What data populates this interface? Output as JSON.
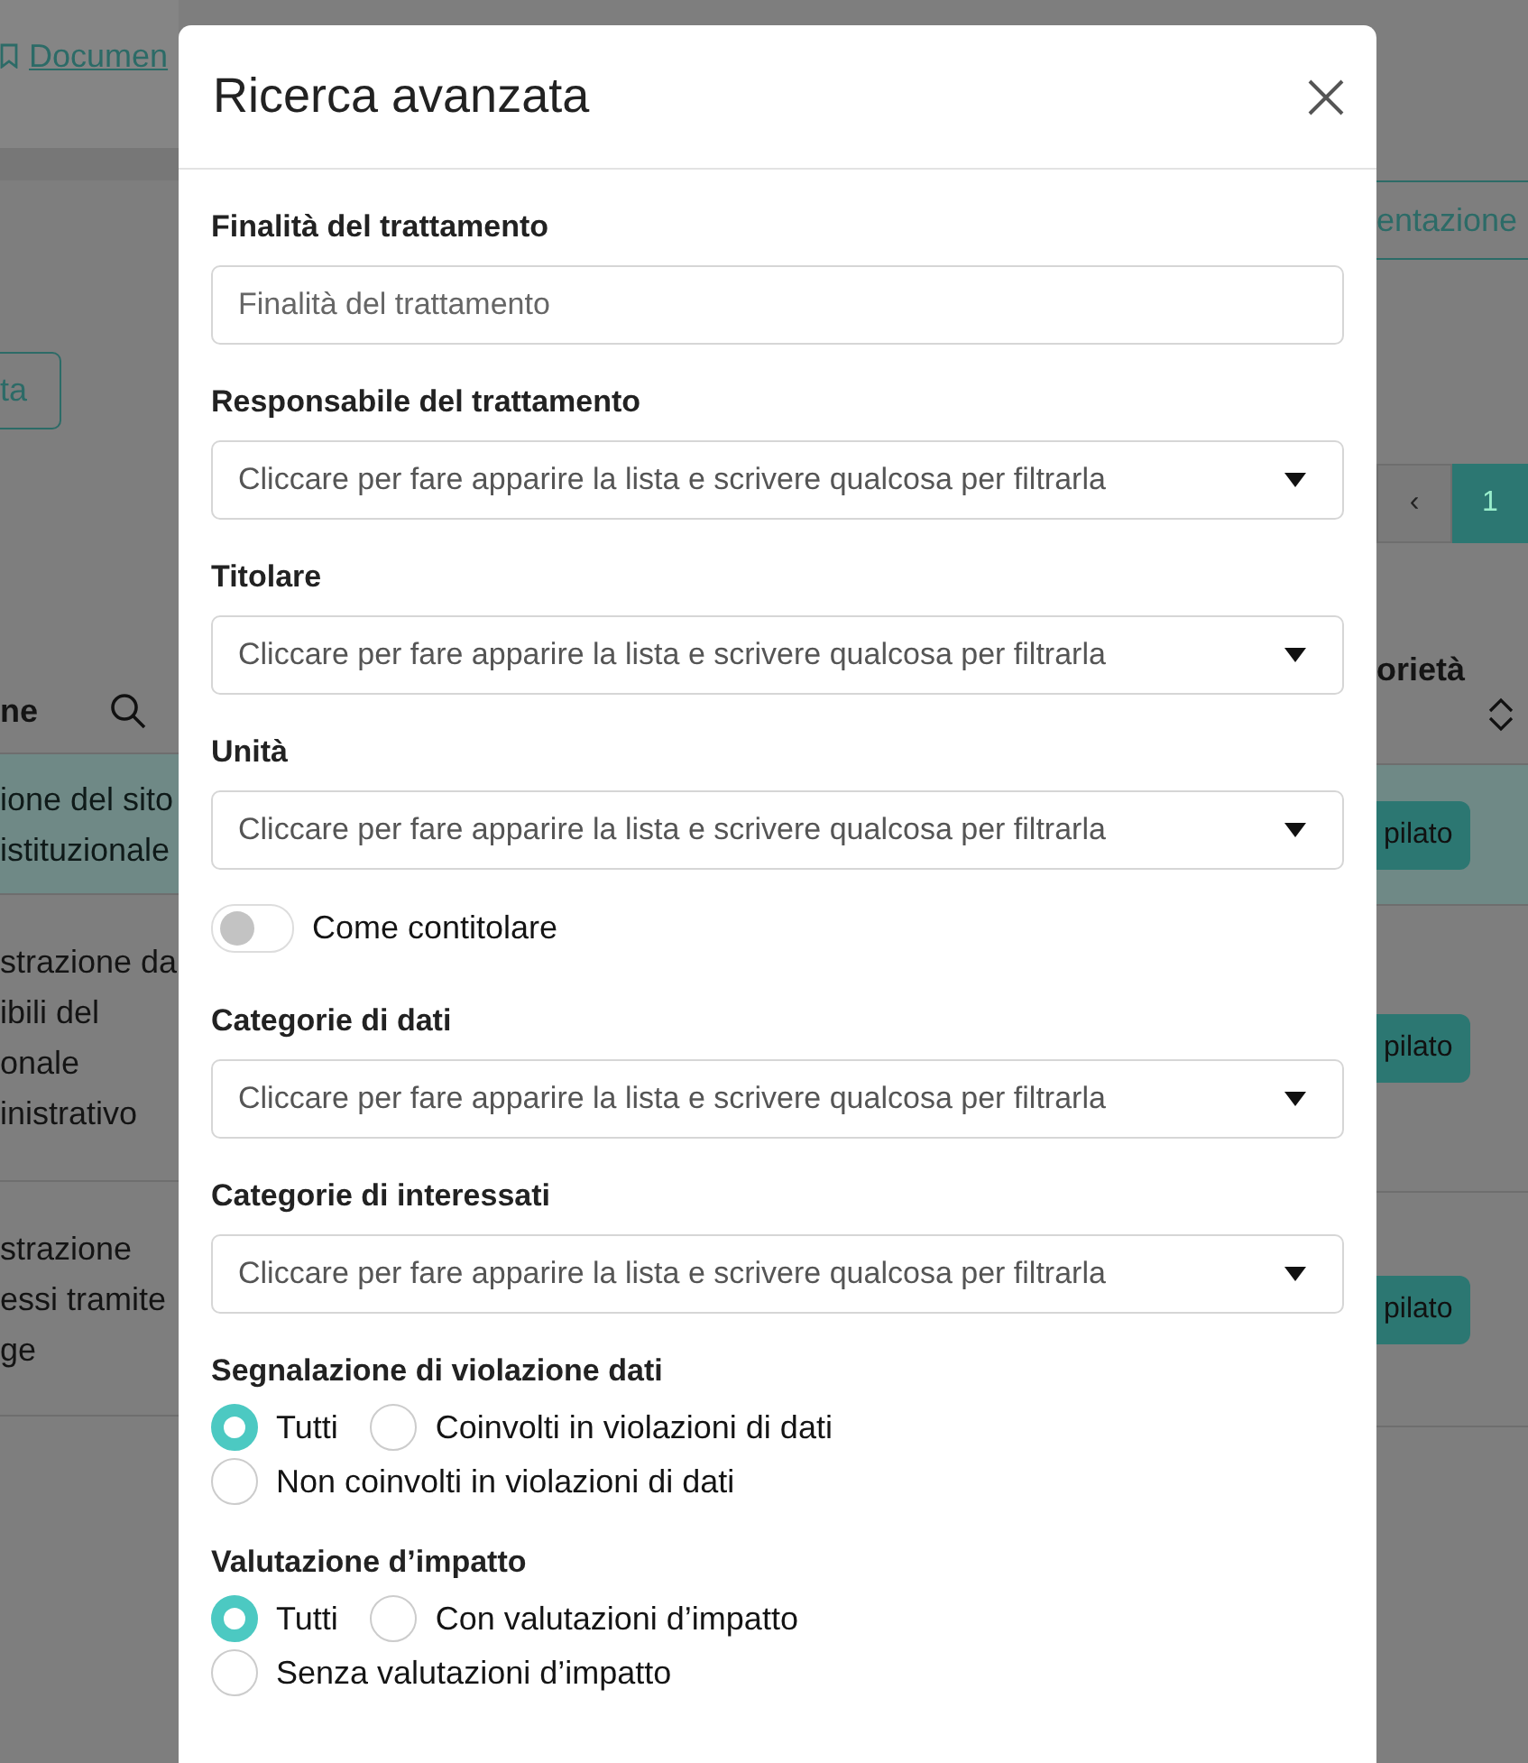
{
  "background": {
    "top_link": "Documen",
    "left_button": "ta",
    "right_button": "entazione",
    "pagination": [
      {
        "label": "‹",
        "selected": false
      },
      {
        "label": "1",
        "selected": true
      }
    ],
    "column_left": "ne",
    "column_right": "orietà",
    "rows": [
      {
        "lines": [
          "ione del sito",
          "istituzionale"
        ],
        "badge": "pilato",
        "selected": true
      },
      {
        "lines": [
          "strazione da",
          "ibili del",
          "onale",
          "inistrativo"
        ],
        "badge": "pilato",
        "selected": false
      },
      {
        "lines": [
          "strazione",
          "essi tramite",
          "ge"
        ],
        "badge": "pilato",
        "selected": false
      }
    ]
  },
  "modal": {
    "title": "Ricerca avanzata",
    "fields": [
      {
        "kind": "text",
        "label": "Finalità del trattamento",
        "placeholder": "Finalità del trattamento"
      },
      {
        "kind": "select",
        "label": "Responsabile del trattamento",
        "placeholder": "Cliccare per fare apparire la lista e scrivere qualcosa per filtrarla"
      },
      {
        "kind": "select",
        "label": "Titolare",
        "placeholder": "Cliccare per fare apparire la lista e scrivere qualcosa per filtrarla"
      },
      {
        "kind": "select",
        "label": "Unità",
        "placeholder": "Cliccare per fare apparire la lista e scrivere qualcosa per filtrarla"
      },
      {
        "kind": "toggle",
        "label": "Come contitolare",
        "on": false
      },
      {
        "kind": "select",
        "label": "Categorie di dati",
        "placeholder": "Cliccare per fare apparire la lista e scrivere qualcosa per filtrarla"
      },
      {
        "kind": "select",
        "label": "Categorie di interessati",
        "placeholder": "Cliccare per fare apparire la lista e scrivere qualcosa per filtrarla"
      },
      {
        "kind": "radio",
        "label": "Segnalazione di violazione dati",
        "options": [
          {
            "label": "Tutti",
            "selected": true
          },
          {
            "label": "Coinvolti in violazioni di dati",
            "selected": false
          },
          {
            "label": "Non coinvolti in violazioni di dati",
            "selected": false
          }
        ]
      },
      {
        "kind": "radio",
        "label": "Valutazione d’impatto",
        "options": [
          {
            "label": "Tutti",
            "selected": true
          },
          {
            "label": "Con valutazioni d’impatto",
            "selected": false
          },
          {
            "label": "Senza valutazioni d’impatto",
            "selected": false
          }
        ]
      }
    ]
  }
}
